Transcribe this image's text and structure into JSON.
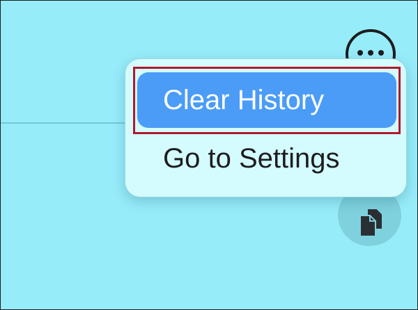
{
  "context_menu": {
    "items": [
      {
        "label": "Clear History",
        "state": "highlighted"
      },
      {
        "label": "Go to Settings",
        "state": "normal"
      }
    ]
  },
  "toolbar": {
    "more_icon": "ellipsis-circle-icon",
    "copy_icon": "copy-documents-icon"
  },
  "colors": {
    "background": "#97ecfa",
    "menu_background": "#d4fcfe",
    "highlight": "#4a9cf7",
    "annotation_box": "#b0182b"
  }
}
